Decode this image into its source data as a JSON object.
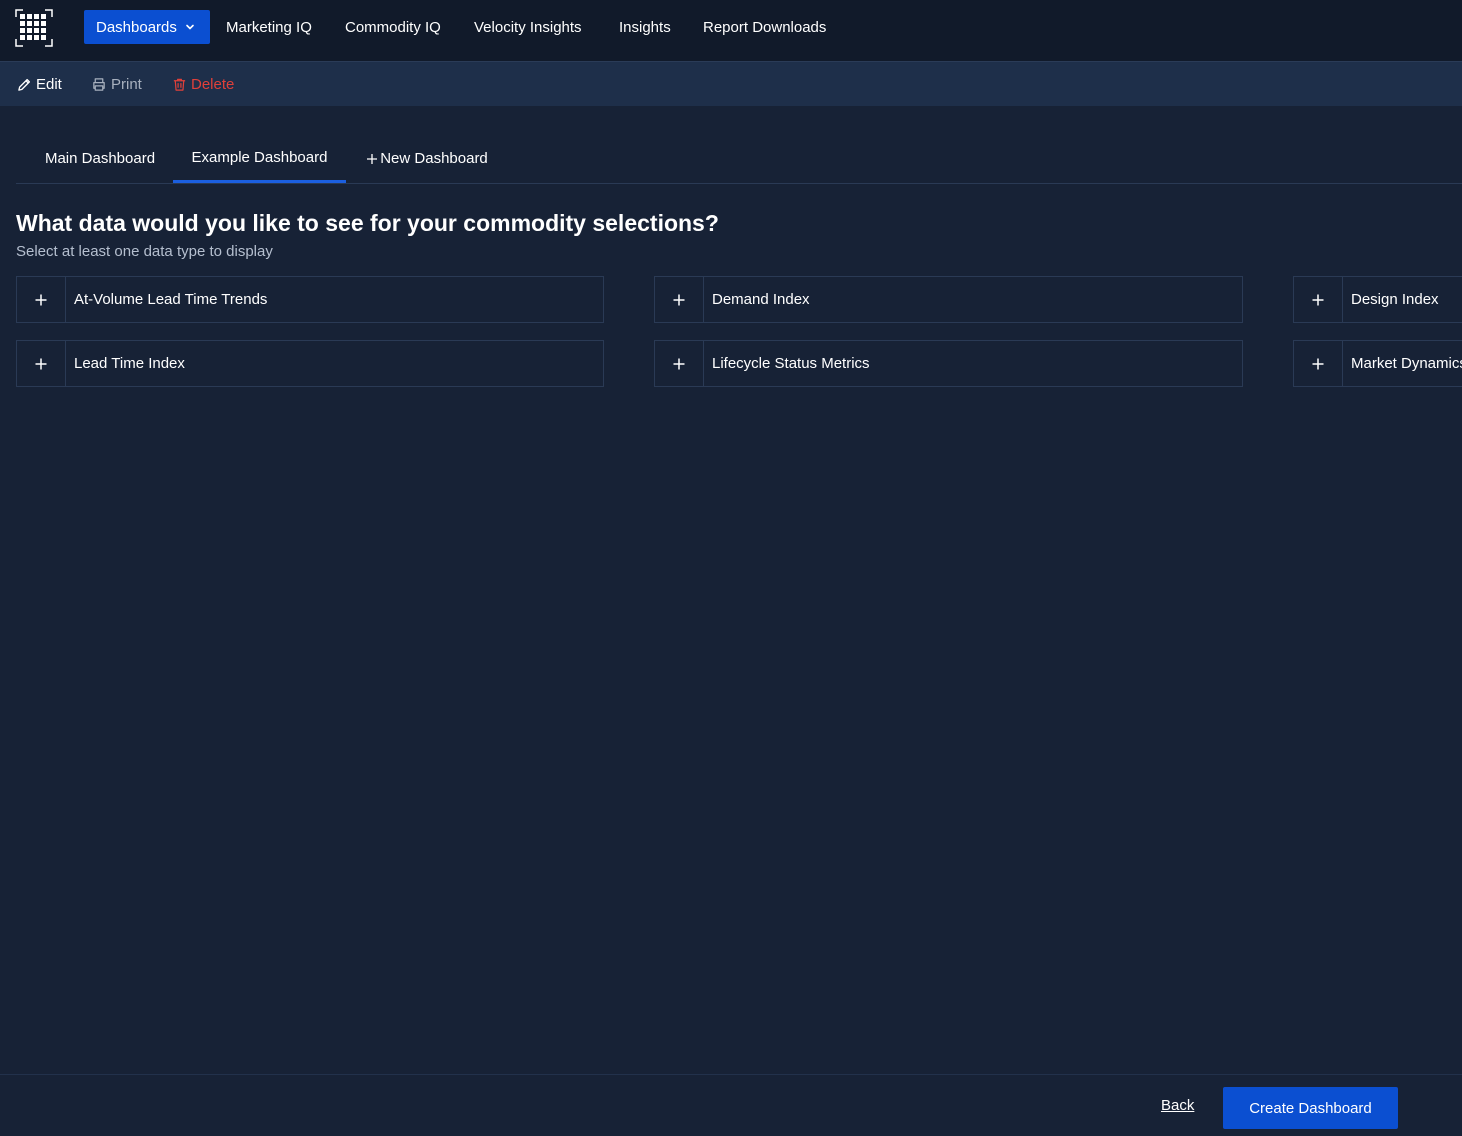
{
  "nav": {
    "dashboards_label": "Dashboards",
    "items": [
      "Marketing IQ",
      "Commodity IQ",
      "Velocity Insights",
      "Insights",
      "Report Downloads"
    ]
  },
  "toolbar": {
    "edit_label": "Edit",
    "print_label": "Print",
    "delete_label": "Delete"
  },
  "tabs": [
    {
      "label": "Main Dashboard"
    },
    {
      "label": "Example Dashboard"
    },
    {
      "label": "New Dashboard"
    }
  ],
  "main": {
    "title": "What data would you like to see for your commodity selections?",
    "subtitle": "Select at least one data type to display",
    "data_types": [
      "At-Volume Lead Time Trends",
      "Demand Index",
      "Design Index",
      "Lead Time Index",
      "Lifecycle Status Metrics",
      "Market Dynamics"
    ]
  },
  "footer": {
    "back_label": "Back",
    "create_label": "Create Dashboard"
  },
  "colors": {
    "accent": "#0b4fd1",
    "background": "#172236",
    "topnav": "#111a2a",
    "toolbar": "#1e2f4a",
    "delete": "#e0403a",
    "muted": "#a7b0be"
  }
}
